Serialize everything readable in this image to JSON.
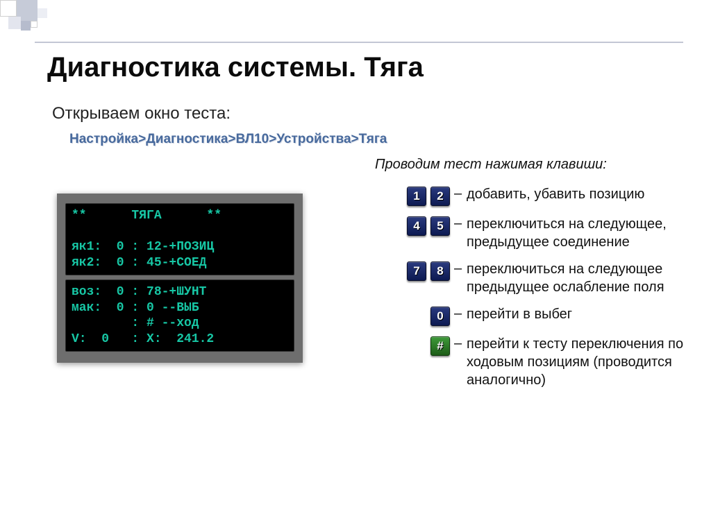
{
  "title": "Диагностика системы. Тяга",
  "subtitle": "Открываем окно теста:",
  "breadcrumb": "Настройка>Диагностика>ВЛ10>Устройства>Тяга",
  "running_test_label": "Проводим тест нажимая клавиши:",
  "terminal": {
    "screen1": "**      ТЯГА      **\n\nяк1:  0 : 12-+ПОЗИЦ\nяк2:  0 : 45-+СОЕД",
    "screen2": "воз:  0 : 78-+ШУНТ\nмак:  0 : 0 --ВЫБ\n        : # --ход\nV:  0   : X:  241.2"
  },
  "legend": {
    "rows": [
      {
        "keys": [
          "1",
          "2"
        ],
        "desc": "добавить, убавить позицию"
      },
      {
        "keys": [
          "4",
          "5"
        ],
        "desc": "переключиться на следующее, предыдущее соединение"
      },
      {
        "keys": [
          "7",
          "8"
        ],
        "desc": "переключиться на следующее предыдущее ослабление поля"
      },
      {
        "keys": [
          "0"
        ],
        "desc": "перейти в выбег"
      },
      {
        "keys": [
          "#"
        ],
        "desc": "перейти к тесту переключения по ходовым позициям (проводится аналогично)",
        "green": true
      }
    ],
    "dash": "–"
  }
}
